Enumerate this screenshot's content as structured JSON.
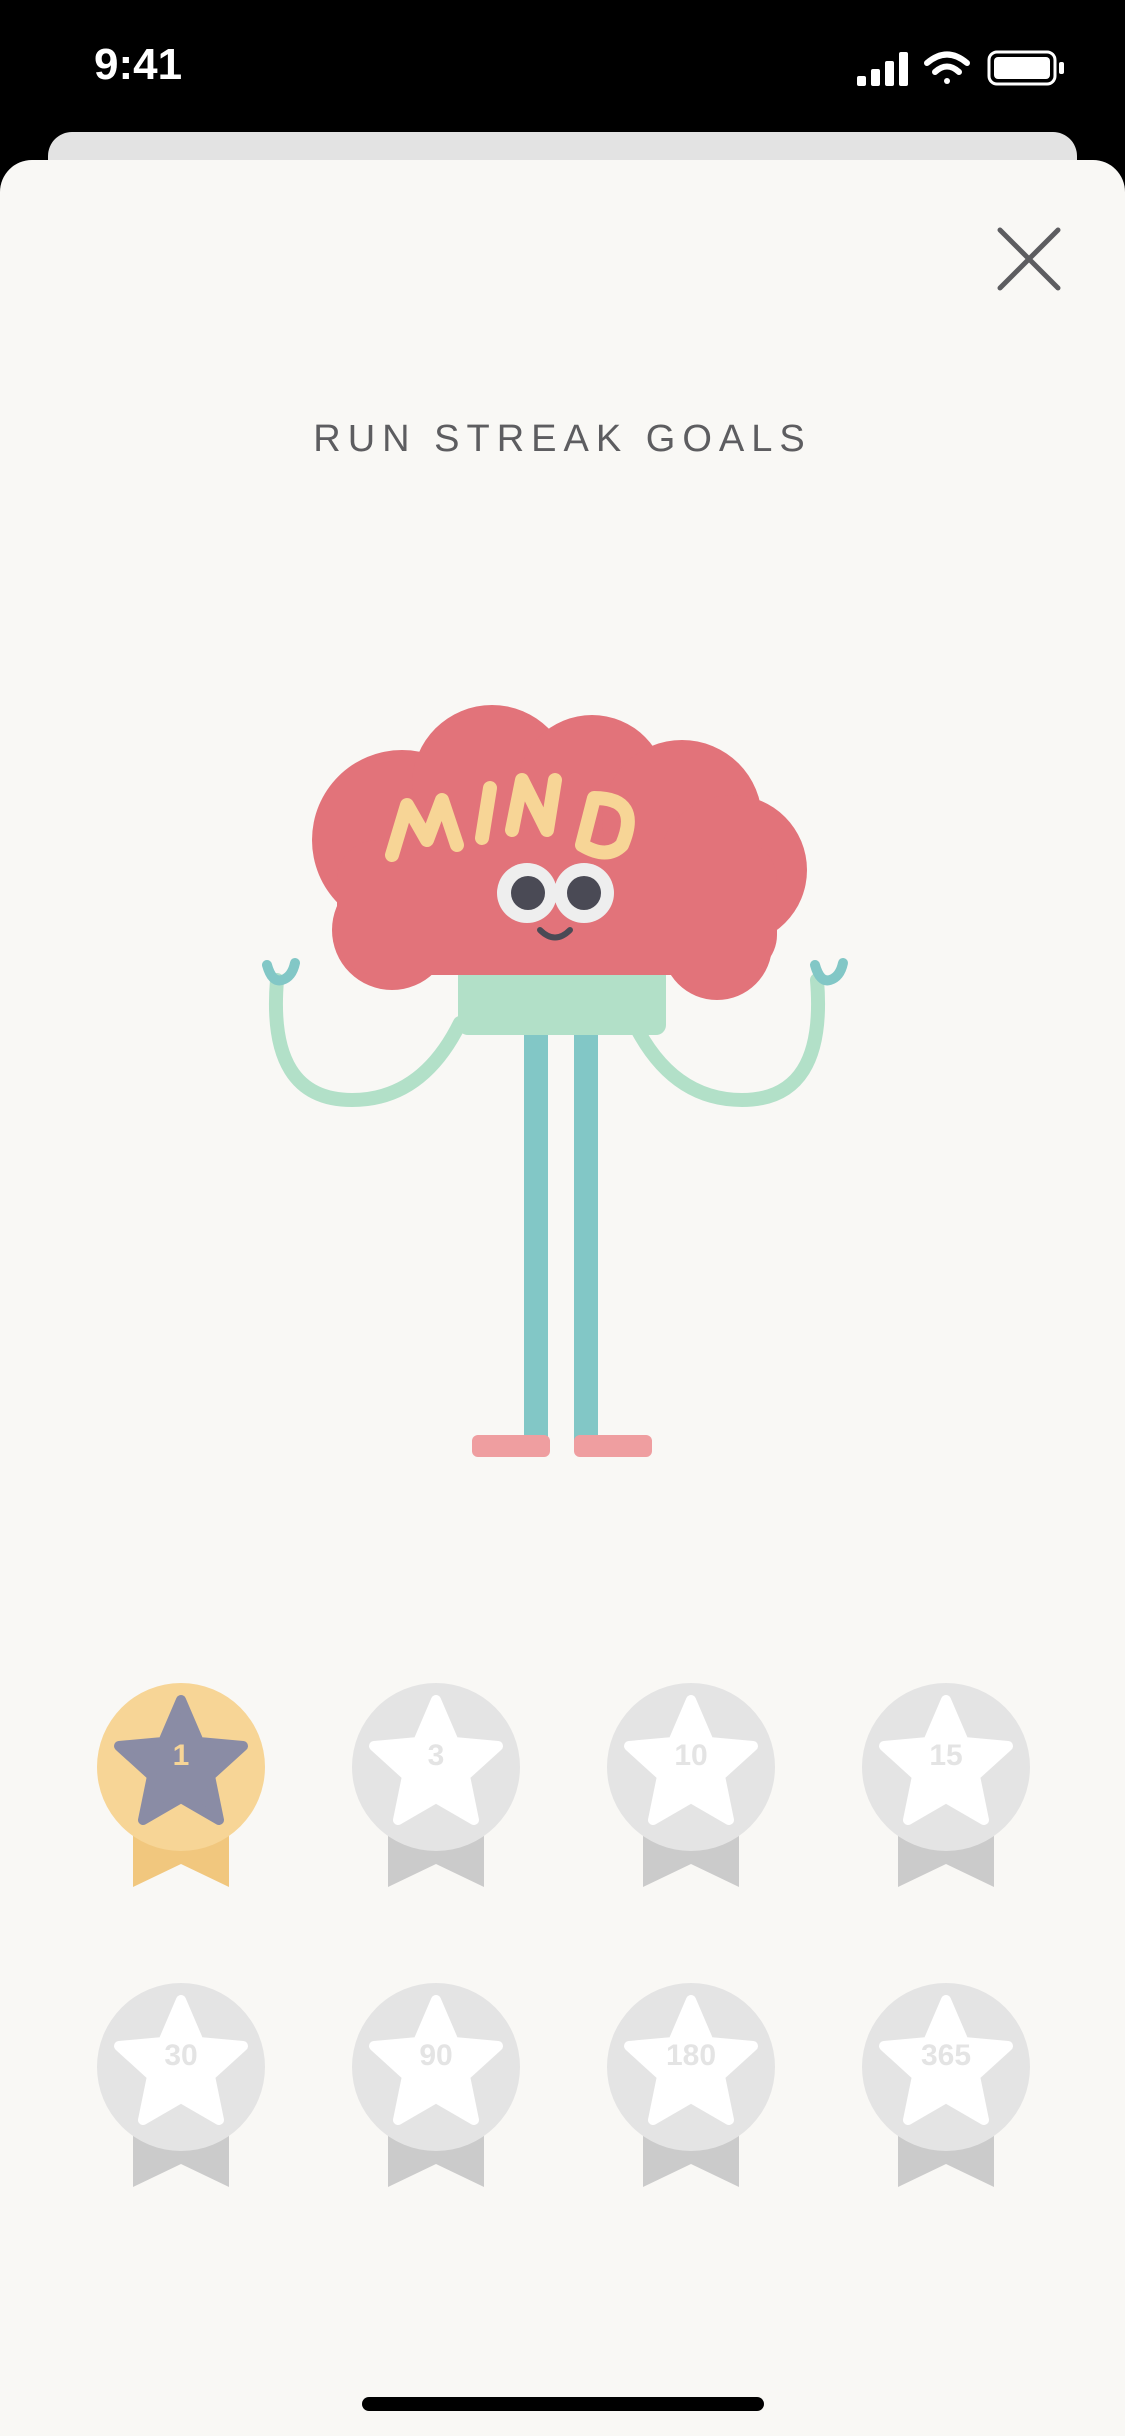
{
  "status_bar": {
    "time": "9:41",
    "signal_icon": "cellular-signal-icon",
    "wifi_icon": "wifi-icon",
    "battery_icon": "battery-icon"
  },
  "header": {
    "close_icon": "close-icon",
    "title": "RUN STREAK GOALS"
  },
  "mascot": {
    "name": "mind-character",
    "text": "MIND"
  },
  "badges": {
    "items": [
      {
        "label": "1",
        "earned": true
      },
      {
        "label": "3",
        "earned": false
      },
      {
        "label": "10",
        "earned": false
      },
      {
        "label": "15",
        "earned": false
      },
      {
        "label": "30",
        "earned": false
      },
      {
        "label": "90",
        "earned": false
      },
      {
        "label": "180",
        "earned": false
      },
      {
        "label": "365",
        "earned": false
      }
    ]
  },
  "colors": {
    "sheet_bg": "#f9f8f5",
    "earned_circle": "#f7d596",
    "earned_ribbon": "#f1c77e",
    "earned_star": "#8a8ca5",
    "locked_circle": "#e4e4e4",
    "locked_ribbon": "#cbcbcb",
    "locked_star": "#ffffff",
    "brain": "#e2737a",
    "body": "#b2e0c8",
    "legs": "#82c7c6",
    "feet": "#ef9ea0",
    "mind_text": "#f7d596"
  }
}
